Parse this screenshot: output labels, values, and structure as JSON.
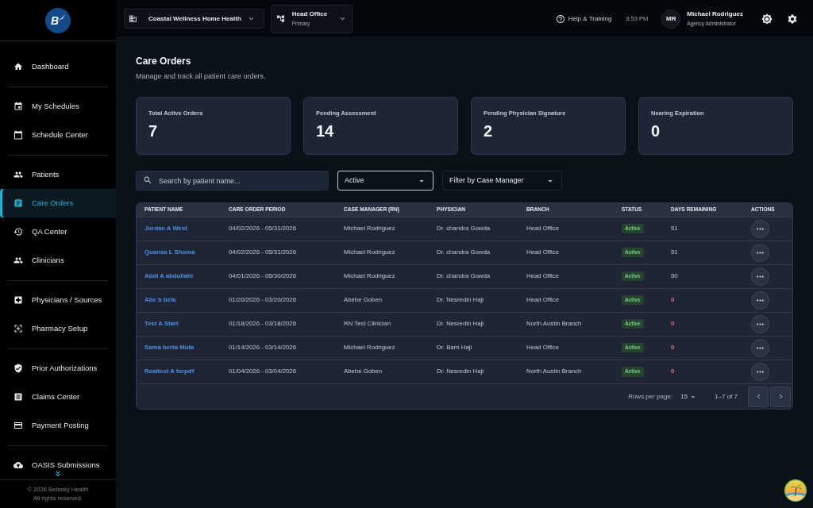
{
  "sidebar": {
    "logo_letter": "B",
    "sections": [
      {
        "items": [
          {
            "label": "Dashboard",
            "selected": false
          }
        ]
      },
      {
        "items": [
          {
            "label": "My Schedules",
            "selected": false
          },
          {
            "label": "Schedule Center",
            "selected": false
          }
        ]
      },
      {
        "items": [
          {
            "label": "Patients",
            "selected": false
          },
          {
            "label": "Care Orders",
            "selected": true
          },
          {
            "label": "QA Center",
            "selected": false
          },
          {
            "label": "Clinicians",
            "selected": false
          }
        ]
      },
      {
        "items": [
          {
            "label": "Physicians / Sources",
            "selected": false
          },
          {
            "label": "Pharmacy Setup",
            "selected": false
          }
        ]
      },
      {
        "items": [
          {
            "label": "Prior Authorizations",
            "selected": false
          },
          {
            "label": "Claims Center",
            "selected": false
          },
          {
            "label": "Payment Posting",
            "selected": false
          }
        ]
      },
      {
        "items": [
          {
            "label": "OASIS Submissions",
            "selected": false
          }
        ]
      }
    ],
    "footer": [
      "© 2026 Betasky Health",
      "All rights reserved."
    ]
  },
  "topbar": {
    "organization": "Coastal Wellness Home Health",
    "branch": {
      "name": "Head Office",
      "type": "Primary"
    },
    "help_link": "Help & Training",
    "time": "8:53 PM",
    "user": {
      "initials": "MR",
      "name": "Michael Rodriguez",
      "role": "Agency Administrator"
    }
  },
  "page": {
    "title": "Care Orders",
    "subtitle": "Manage and track all patient care orders."
  },
  "stats": [
    {
      "label": "Total Active Orders",
      "value": "7"
    },
    {
      "label": "Pending Assessment",
      "value": "14"
    },
    {
      "label": "Pending Physician Signature",
      "value": "2"
    },
    {
      "label": "Nearing Expiration",
      "value": "0"
    }
  ],
  "filters": {
    "search": {
      "placeholder": "Search by patient name..."
    },
    "status_filter": {
      "value": "Active"
    },
    "case_manager_filter": {
      "label": "Filter by Case Manager"
    }
  },
  "table": {
    "columns": [
      "PATIENT NAME",
      "CARE ORDER PERIOD",
      "CASE MANAGER (RN)",
      "PHYSICIAN",
      "BRANCH",
      "STATUS",
      "DAYS REMAINING",
      "ACTIONS"
    ],
    "rows": [
      {
        "patient_name": "Jordan A West",
        "care_order_period": "04/02/2026 - 05/31/2026",
        "case_manager": "Michael Rodriguez",
        "physician": "Dr. chandra Gowda",
        "branch": "Head Office",
        "status": "Active",
        "days_remaining": "51",
        "expired": false
      },
      {
        "patient_name": "Quansa L Shoma",
        "care_order_period": "04/02/2026 - 05/31/2026",
        "case_manager": "Michael Rodriguez",
        "physician": "Dr. chandra Gowda",
        "branch": "Head Office",
        "status": "Active",
        "days_remaining": "51",
        "expired": false
      },
      {
        "patient_name": "Abdi A abdullahi",
        "care_order_period": "04/01/2026 - 05/30/2026",
        "case_manager": "Michael Rodriguez",
        "physician": "Dr. chandra Gowda",
        "branch": "Head Office",
        "status": "Active",
        "days_remaining": "50",
        "expired": false
      },
      {
        "patient_name": "Abe b bela",
        "care_order_period": "01/20/2026 - 03/20/2026",
        "case_manager": "Abebe Goben",
        "physician": "Dr. Nesredin Haji",
        "branch": "Head Office",
        "status": "Active",
        "days_remaining": "0",
        "expired": true
      },
      {
        "patient_name": "Test A Start",
        "care_order_period": "01/18/2026 - 03/18/2026",
        "case_manager": "RN Test Clinician",
        "physician": "Dr. Nesredin Haji",
        "branch": "North Austin Branch",
        "status": "Active",
        "days_remaining": "0",
        "expired": true
      },
      {
        "patient_name": "Sama berta Muta",
        "care_order_period": "01/14/2026 - 03/14/2026",
        "case_manager": "Michael Rodriguez",
        "physician": "Dr. Barn Haji",
        "branch": "Head Office",
        "status": "Active",
        "days_remaining": "0",
        "expired": true
      },
      {
        "patient_name": "Realtest A forpdf",
        "care_order_period": "01/04/2026 - 03/04/2026",
        "case_manager": "Abebe Goben",
        "physician": "Dr. Nesredin Haji",
        "branch": "North Austin Branch",
        "status": "Active",
        "days_remaining": "0",
        "expired": true
      }
    ]
  },
  "pagination": {
    "rows_per_page_label": "Rows per page:",
    "rows_per_page": "15",
    "range": "1–7 of 7"
  }
}
